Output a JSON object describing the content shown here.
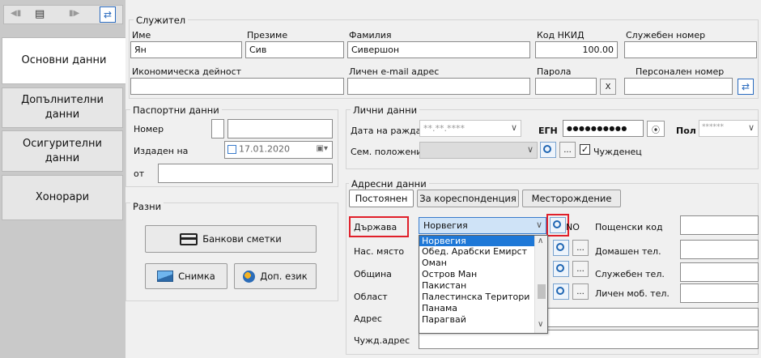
{
  "sidebar": {
    "tabs": [
      {
        "label": "Основни данни"
      },
      {
        "label": "Допълнителни данни"
      },
      {
        "label": "Осигурителни данни"
      },
      {
        "label": "Хонорари"
      }
    ]
  },
  "employee": {
    "section_title": "Служител",
    "first_name_label": "Име",
    "first_name": "Ян",
    "middle_name_label": "Презиме",
    "middle_name": "Сив",
    "last_name_label": "Фамилия",
    "last_name": "Сивершон",
    "nkid_label": "Код НКИД",
    "nkid": "100.00",
    "service_no_label": "Служебен номер",
    "service_no": "",
    "econ_activity_label": "Икономическа дейност",
    "econ_activity": "",
    "email_label": "Личен e-mail адрес",
    "email": "",
    "password_label": "Парола",
    "password": "",
    "clear_label": "X",
    "personal_no_label": "Персонален номер",
    "personal_no": ""
  },
  "passport": {
    "title": "Паспортни данни",
    "number_label": "Номер",
    "issued_label": "Издаден на",
    "issued_date": "17.01.2020",
    "from_label": "от"
  },
  "misc": {
    "title": "Разни",
    "bank_accounts": "Банкови сметки",
    "photo": "Снимка",
    "extra_language": "Доп. език"
  },
  "personal": {
    "title": "Лични данни",
    "birth_date_label": "Дата на раждане",
    "birth_date_placeholder": "**.**.****",
    "egn_label": "ЕГН",
    "egn_masked": "●●●●●●●●●●",
    "gender_label": "Пол",
    "gender_masked": "******",
    "marital_label": "Сем. положение",
    "more_label": "...",
    "foreigner_label": "Чужденец"
  },
  "address": {
    "title": "Адресни данни",
    "tabs": [
      "Постоянен",
      "За кореспонденция",
      "Месторождение"
    ],
    "country_label": "Държава",
    "country_value": "Норвегия",
    "country_code": "NO",
    "settlement_label": "Нас. място",
    "municipality_label": "Община",
    "region_label": "Област",
    "address_label": "Адрес",
    "foreign_address_label": "Чужд.адрес",
    "postal_code_label": "Пощенски код",
    "home_phone_label": "Домашен тел.",
    "work_phone_label": "Служебен тел.",
    "mobile_label": "Личен моб. тел.",
    "dropdown_options": [
      "Норвегия",
      "Обед. Арабски Емирст",
      "Оман",
      "Остров Ман",
      "Пакистан",
      "Палестинска Територи",
      "Панама",
      "Парагвай"
    ]
  },
  "colors": {
    "highlight_red": "#e0202a",
    "selection_blue": "#1e78d7",
    "panel_bg": "#f0f0f0"
  }
}
